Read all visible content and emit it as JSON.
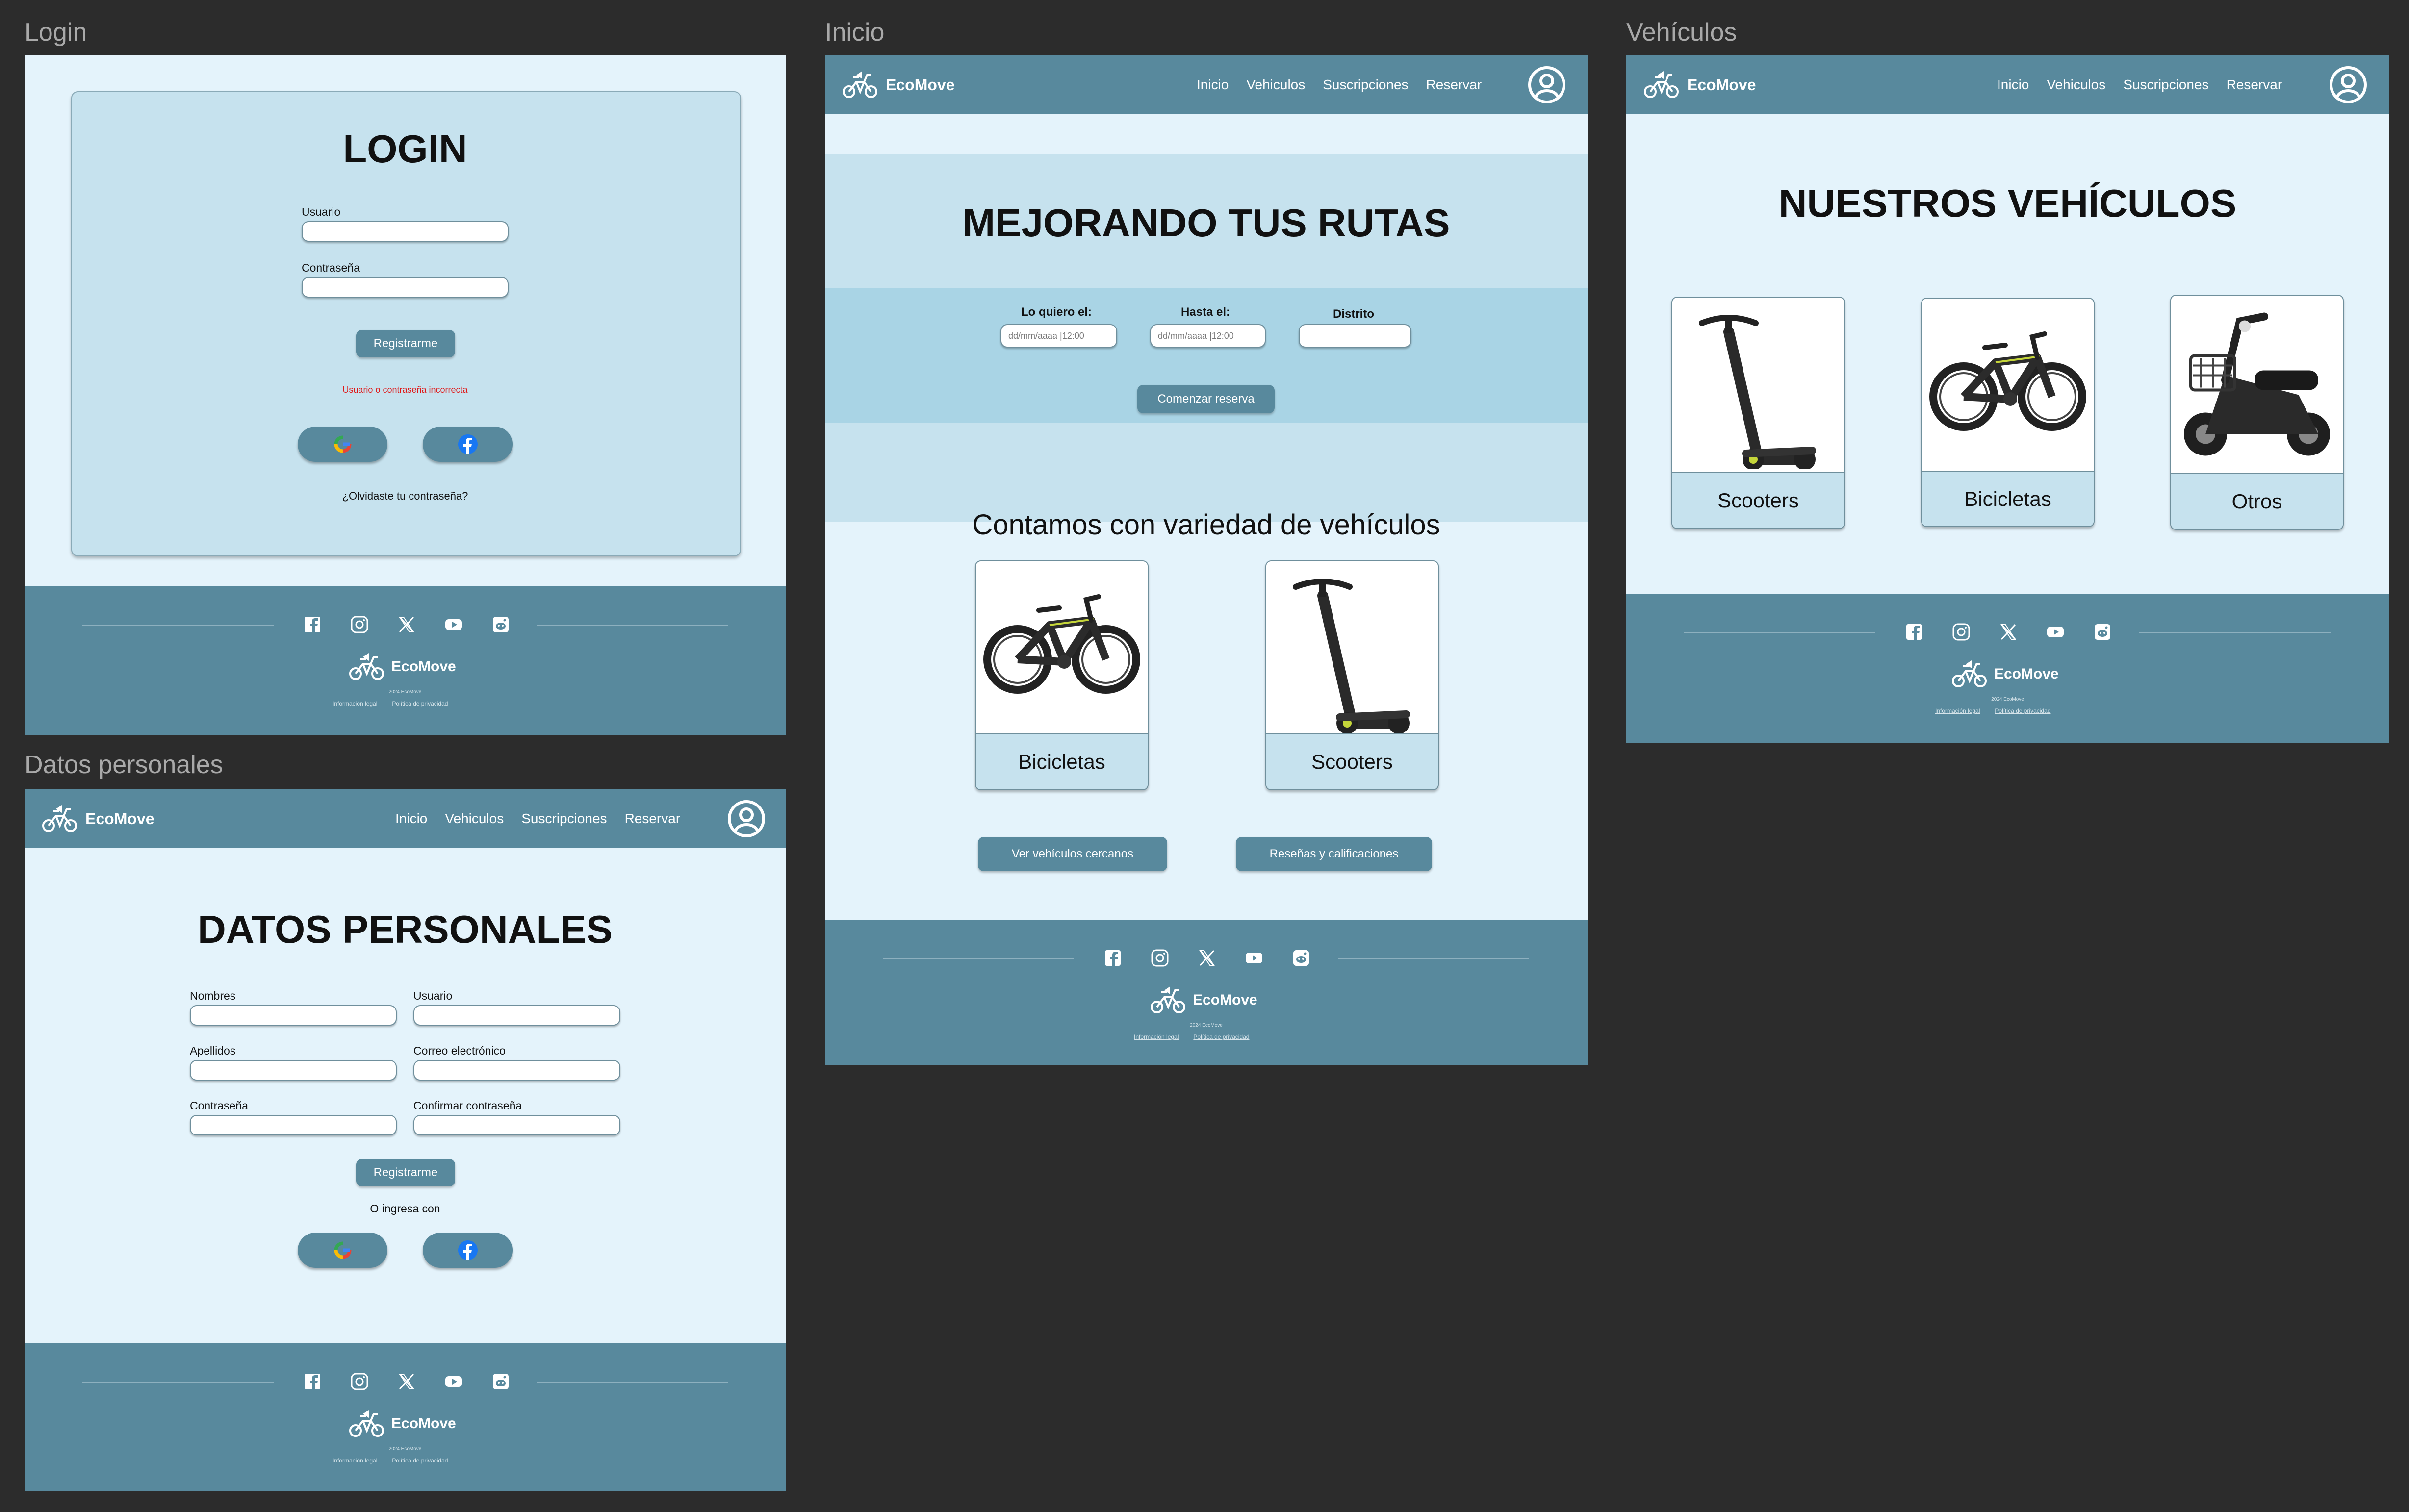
{
  "labels": {
    "login": "Login",
    "inicio": "Inicio",
    "vehiculos": "Vehículos",
    "datos": "Datos personales"
  },
  "nav": {
    "brand": "EcoMove",
    "links": [
      "Inicio",
      "Vehiculos",
      "Suscripciones",
      "Reservar"
    ]
  },
  "footer": {
    "brand": "EcoMove",
    "copy": "2024 EcoMove",
    "legal": "Información legal",
    "privacy": "Política de privacidad"
  },
  "login": {
    "title": "LOGIN",
    "user_label": "Usuario",
    "pass_label": "Contraseña",
    "register": "Registrarme",
    "error": "Usuario o contraseña incorrecta",
    "forgot": "¿Olvidaste tu contraseña?"
  },
  "inicio": {
    "hero_title": "MEJORANDO TUS RUTAS",
    "from_label": "Lo quiero el:",
    "from_placeholder": "dd/mm/aaaa |12:00",
    "to_label": "Hasta el:",
    "to_placeholder": "dd/mm/aaaa |12:00",
    "district_label": "Distrito",
    "start": "Comenzar reserva",
    "variety_title": "Contamos con variedad de vehículos",
    "cards": [
      "Bicicletas",
      "Scooters"
    ],
    "btn_near": "Ver vehículos cercanos",
    "btn_reviews": "Reseñas y calificaciones"
  },
  "vehiculos": {
    "title": "NUESTROS VEHÍCULOS",
    "cards": [
      "Scooters",
      "Bicicletas",
      "Otros"
    ]
  },
  "datos": {
    "title": "DATOS PERSONALES",
    "nombres": "Nombres",
    "usuario": "Usuario",
    "apellidos": "Apellidos",
    "correo": "Correo electrónico",
    "contrasena": "Contraseña",
    "confirmar": "Confirmar contraseña",
    "register": "Registrarme",
    "or": "O ingresa con"
  },
  "colors": {
    "nav": "#58899d",
    "page": "#e4f3fb",
    "panel": "#c6e2ee",
    "accent_band": "#a9d4e5",
    "canvas": "#2c2c2c"
  },
  "icons": [
    "bike-logo-icon",
    "user-circle-icon",
    "facebook-icon",
    "instagram-icon",
    "x-icon",
    "youtube-icon",
    "reddit-icon",
    "google-icon"
  ]
}
